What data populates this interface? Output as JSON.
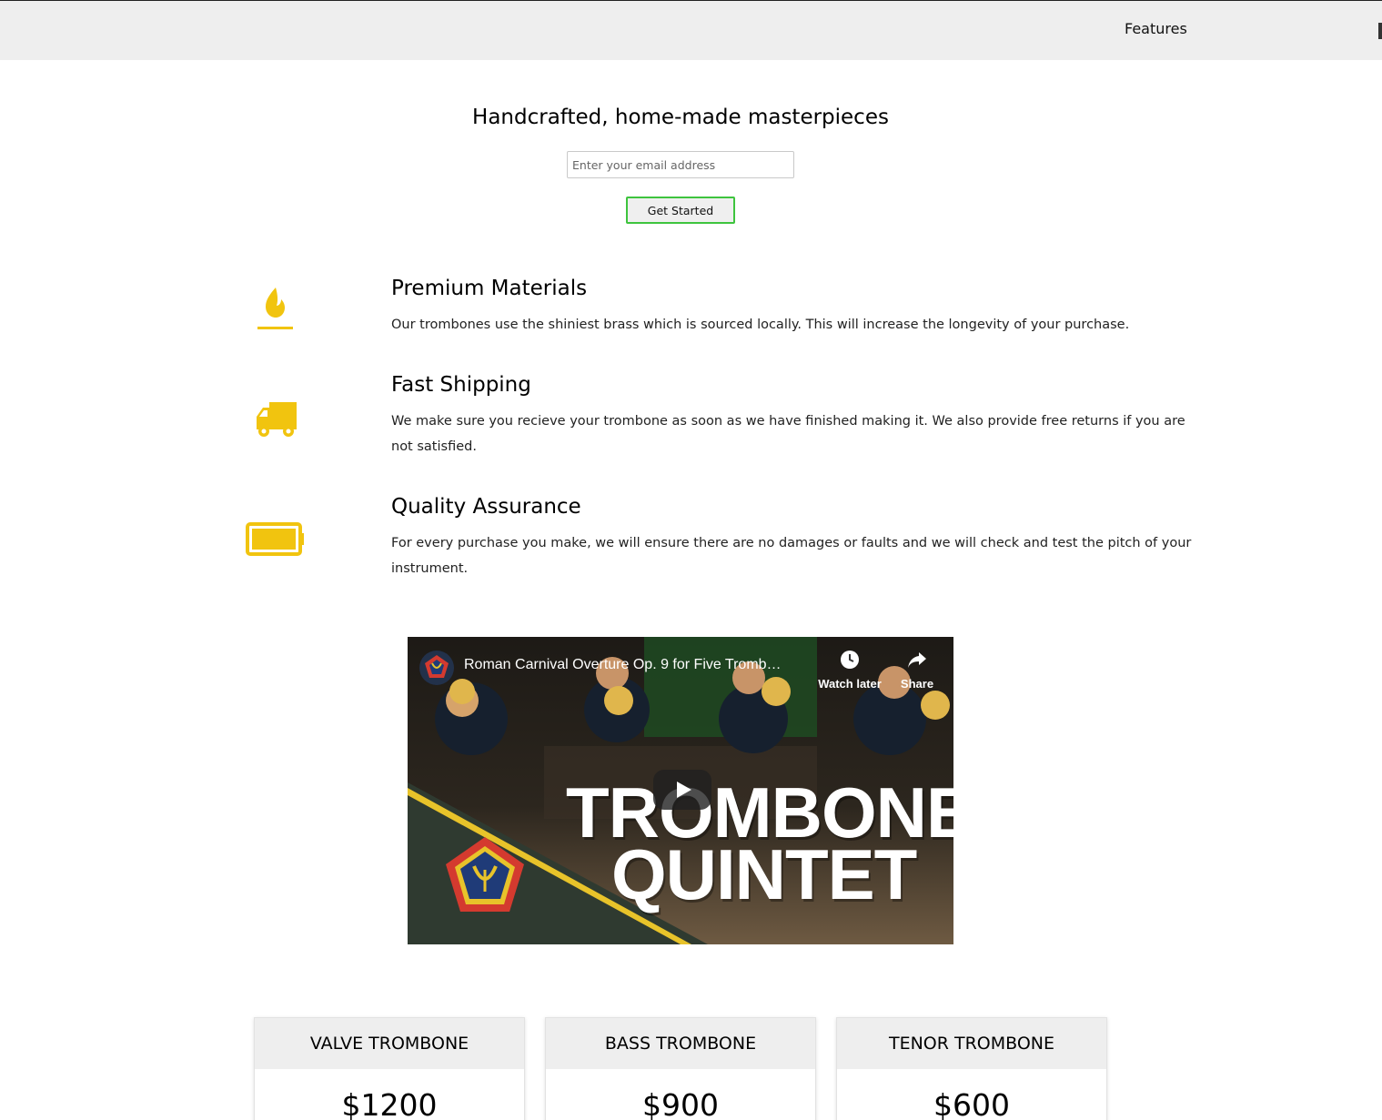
{
  "nav": {
    "features_label": "Features"
  },
  "hero": {
    "title": "Handcrafted, home-made masterpieces",
    "email_placeholder": "Enter your email address",
    "cta_label": "Get Started"
  },
  "features": [
    {
      "icon": "flame-icon",
      "title": "Premium Materials",
      "description": "Our trombones use the shiniest brass which is sourced locally. This will increase the longevity of your purchase."
    },
    {
      "icon": "truck-icon",
      "title": "Fast Shipping",
      "description": "We make sure you recieve your trombone as soon as we have finished making it. We also provide free returns if you are not satisfied."
    },
    {
      "icon": "battery-full-icon",
      "title": "Quality Assurance",
      "description": "For every purchase you make, we will ensure there are no damages or faults and we will check and test the pitch of your instrument."
    }
  ],
  "video": {
    "title": "Roman Carnival Overture Op. 9 for Five Tromb…",
    "watch_later_label": "Watch later",
    "share_label": "Share",
    "thumbnail_line1": "TROMBONE",
    "thumbnail_line2": "QUINTET"
  },
  "pricing": [
    {
      "name": "VALVE TROMBONE",
      "price": "$1200"
    },
    {
      "name": "BASS TROMBONE",
      "price": "$900"
    },
    {
      "name": "TENOR TROMBONE",
      "price": "$600"
    }
  ],
  "colors": {
    "accent_yellow": "#f1c40f",
    "cta_border": "#3ec43e",
    "header_bg": "#eeeeee"
  }
}
